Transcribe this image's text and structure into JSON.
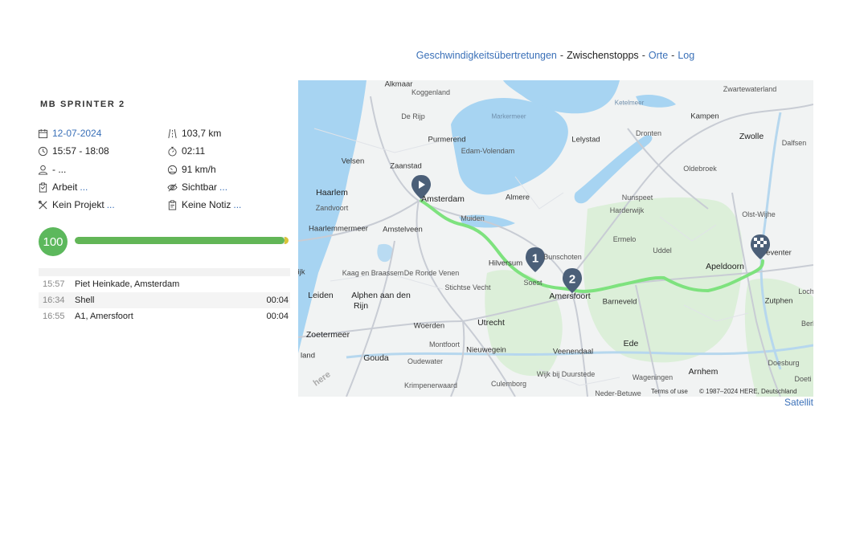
{
  "nav": {
    "items": [
      {
        "label": "Geschwindigkeitsübertretungen",
        "active": false
      },
      {
        "label": "Zwischenstopps",
        "active": true
      },
      {
        "label": "Orte",
        "active": false
      },
      {
        "label": "Log",
        "active": false
      }
    ],
    "separator": "-"
  },
  "vehicle": {
    "name": "MB SPRINTER 2"
  },
  "trip": {
    "date": "12-07-2024",
    "time_range": "15:57 - 18:08",
    "driver": "- ...",
    "distance": "103,7 km",
    "duration": "02:11",
    "max_speed": "91 km/h",
    "category": "Arbeit",
    "visibility": "Sichtbar",
    "project": "Kein Projekt",
    "note": "Keine Notiz",
    "more": "..."
  },
  "score": {
    "value": "100",
    "fraction": 0.98
  },
  "stops": [
    {
      "time": "15:57",
      "name": "Piet Heinkade, Amsterdam",
      "duration": ""
    },
    {
      "time": "16:34",
      "name": "Shell",
      "duration": "00:04"
    },
    {
      "time": "16:55",
      "name": "A1, Amersfoort",
      "duration": "00:04"
    }
  ],
  "map": {
    "markers": [
      "1",
      "2"
    ],
    "labels": {
      "alkmaar": "Alkmaar",
      "koggenland": "Koggenland",
      "dijk": "De Rijp",
      "purmerend": "Purmerend",
      "edam": "Edam-Volendam",
      "markermeer": "Markermeer",
      "lelystad": "Lelystad",
      "dronten": "Dronten",
      "kampen": "Kampen",
      "zwartewaterland": "Zwartewaterland",
      "ketelmeer": "Ketelmeer",
      "zwolle": "Zwolle",
      "dalfsen": "Dalfsen",
      "velsen": "Velsen",
      "zaanstad": "Zaanstad",
      "amsterdam": "Amsterdam",
      "almere": "Almere",
      "oldebroek": "Oldebroek",
      "haarlem": "Haarlem",
      "zandvoort": "Zandvoort",
      "nunspeet": "Nunspeet",
      "harderwijk": "Harderwijk",
      "olst": "Olst-Wijhe",
      "muiden": "Muiden",
      "haarlemmermeer": "Haarlemmermeer",
      "amstelveen": "Amstelveen",
      "ermelo": "Ermelo",
      "uddel": "Uddel",
      "hilversum": "Hilversum",
      "bunschoten": "Bunschoten",
      "apeldoorn": "Apeldoorn",
      "deventer": "eventer",
      "lijk": "ijk",
      "kaag": "Kaag en Braassem",
      "ronde": "De Ronde Venen",
      "stichtse": "Stichtse Vecht",
      "soest": "Soest",
      "amersfoort": "Amersfoort",
      "barneveld": "Barneveld",
      "leiden": "Leiden",
      "alphen": "Alphen aan den",
      "rijn": "Rijn",
      "utrecht": "Utrecht",
      "zutphen": "Zutphen",
      "woerden": "Woerden",
      "zoetermeer": "Zoetermeer",
      "montfoort": "Montfoort",
      "nieuwegein": "Nieuwegein",
      "veenendaal": "Veenendaal",
      "ede": "Ede",
      "oudewater": "Oudewater",
      "gouda": "Gouda",
      "arnhem": "Arnhem",
      "doesburg": "Doesburg",
      "wijk": "Wijk bij Duurstede",
      "wageningen": "Wageningen",
      "krimpen": "Krimpenerwaard",
      "culemborg": "Culemborg",
      "neder": "Neder-Betuwe",
      "iland": "land",
      "doeti": "Doeti",
      "loch": "Loch",
      "berl": "Berl"
    },
    "terms": "Terms of use",
    "copyright": "© 1987–2024 HERE, Deutschland",
    "brand": "here"
  },
  "satellite_label": "Satellit",
  "colors": {
    "link": "#3a70b8",
    "route": "#7ee27e",
    "score": "#5cb85c",
    "marker": "#4b5f78"
  }
}
